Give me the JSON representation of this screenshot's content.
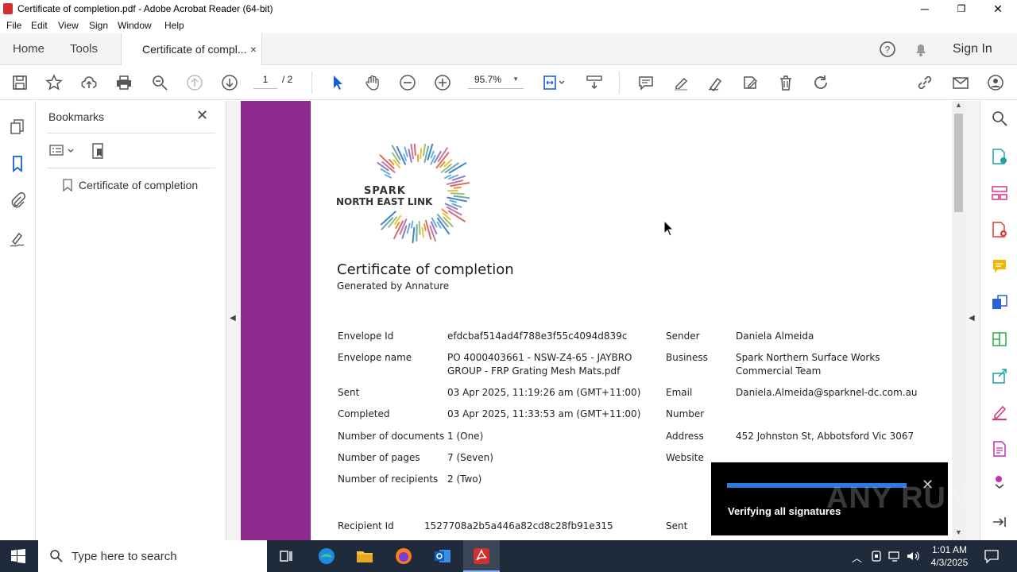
{
  "window": {
    "title": "Certificate of completion.pdf - Adobe Acrobat Reader (64-bit)",
    "minimize": "─",
    "maximize": "❐",
    "close": "✕"
  },
  "menu": [
    "File",
    "Edit",
    "View",
    "Sign",
    "Window",
    "Help"
  ],
  "tabs": {
    "home": "Home",
    "tools": "Tools",
    "active": "Certificate of compl...",
    "active_close": "×",
    "sign_in": "Sign In"
  },
  "toolbar": {
    "page_current": "1",
    "page_total": "/ 2",
    "zoom": "95.7%"
  },
  "bookmarks": {
    "title": "Bookmarks",
    "close": "✕",
    "items": [
      "Certificate of completion"
    ]
  },
  "document": {
    "logo_line1": "SPARK",
    "logo_line2": "NORTH EAST LINK",
    "heading": "Certificate of completion",
    "subheading": "Generated by Annature",
    "left_fields": [
      {
        "label": "Envelope Id",
        "value": "efdcbaf514ad4f788e3f55c4094d839c"
      },
      {
        "label": "Envelope name",
        "value": "PO 4000403661 - NSW-Z4-65 - JAYBRO",
        "value2": "GROUP - FRP Grating Mesh Mats.pdf"
      },
      {
        "label": "Sent",
        "value": "03 Apr 2025, 11:19:26 am (GMT+11:00)"
      },
      {
        "label": "Completed",
        "value": "03 Apr 2025, 11:33:53 am (GMT+11:00)"
      },
      {
        "label": "Number of documents",
        "value": "1 (One)"
      },
      {
        "label": "Number of pages",
        "value": "7 (Seven)"
      },
      {
        "label": "Number of recipients",
        "value": "2 (Two)"
      }
    ],
    "right_fields": [
      {
        "label": "Sender",
        "value": "Daniela Almeida"
      },
      {
        "label": "Business",
        "value": "Spark Northern Surface Works",
        "value2": "Commercial Team"
      },
      {
        "label": "Email",
        "value": "Daniela.Almeida@sparknel-dc.com.au"
      },
      {
        "label": "Number",
        "value": ""
      },
      {
        "label": "Address",
        "value": "452 Johnston St, Abbotsford Vic 3067"
      },
      {
        "label": "Website",
        "value": ""
      }
    ],
    "recipient_label": "Recipient Id",
    "recipient_value": "1527708a2b5a446a82cd8c28fb91e315",
    "recipient_sent_label": "Sent"
  },
  "toast": {
    "message": "Verifying all signatures",
    "close": "✕",
    "progress": 0.94
  },
  "watermark": "ANY RUN",
  "taskbar": {
    "search_placeholder": "Type here to search",
    "time": "1:01 AM",
    "date": "4/3/2025"
  },
  "colors": {
    "purple_band": "#8e2a8e",
    "progress_blue": "#2d7ae1",
    "acrobat_red": "#d32f2f"
  }
}
